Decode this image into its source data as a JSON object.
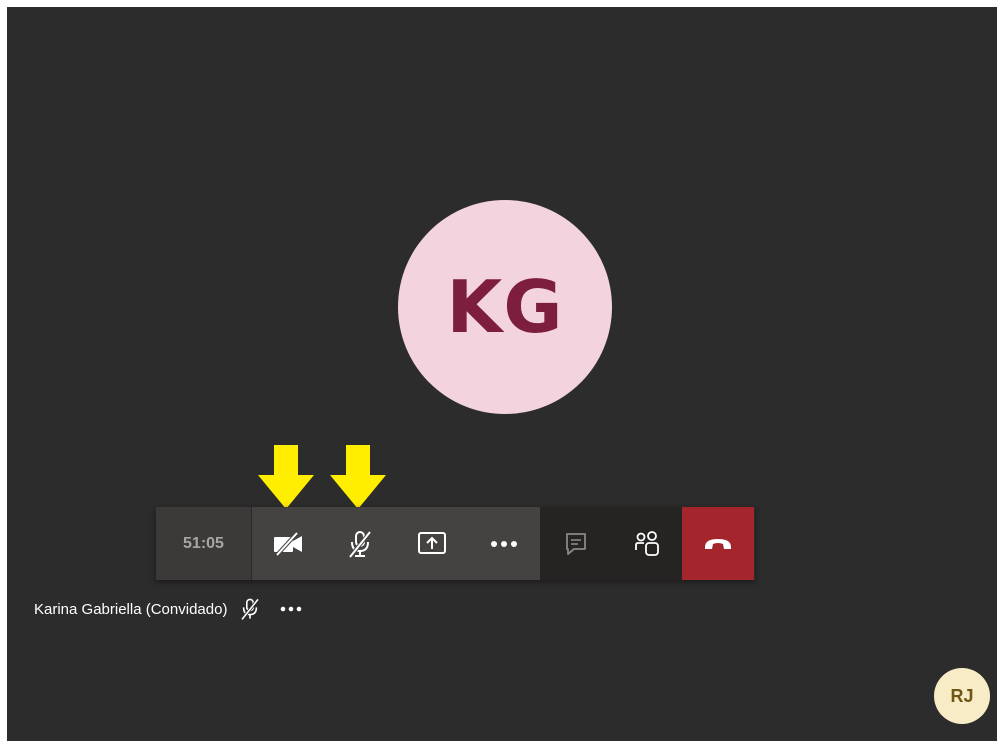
{
  "participant": {
    "initials": "KG",
    "caption_name": "Karina Gabriella (Convidado)"
  },
  "toolbar": {
    "timer": "51:05",
    "buttons": [
      {
        "name": "camera-off",
        "icon": "video-off-icon",
        "state": "off"
      },
      {
        "name": "microphone-muted",
        "icon": "mic-off-icon",
        "state": "muted"
      },
      {
        "name": "share-screen",
        "icon": "share-screen-icon"
      },
      {
        "name": "more-actions",
        "icon": "ellipsis-icon"
      },
      {
        "name": "chat",
        "icon": "chat-icon"
      },
      {
        "name": "participants",
        "icon": "people-icon"
      },
      {
        "name": "hang-up",
        "icon": "phone-hangup-icon"
      }
    ]
  },
  "self_view": {
    "initials": "RJ"
  },
  "annotations": {
    "arrow_color": "#ffee00",
    "arrows": [
      "camera-button",
      "microphone-button"
    ]
  },
  "colors": {
    "stage_bg": "#2d2c2c",
    "avatar_bg": "#f3d3dd",
    "avatar_text": "#7d1e3f",
    "hangup_red": "#a4262c",
    "self_avatar_bg": "#f8ecc7"
  }
}
